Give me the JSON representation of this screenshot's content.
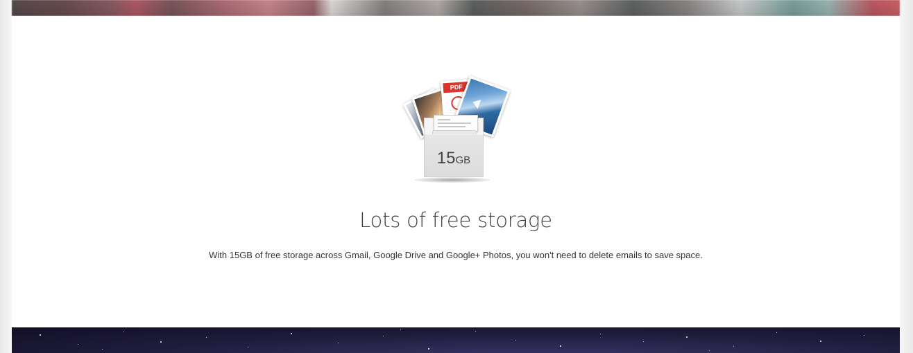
{
  "feature": {
    "storage_number": "15",
    "storage_unit": "GB",
    "pdf_badge": "PDF",
    "title": "Lots of free storage",
    "description": "With 15GB of free storage across Gmail, Google Drive and Google+ Photos, you won't need to delete emails to save space."
  },
  "icons": {
    "storage": "folder-with-files-icon",
    "pdf": "pdf-file-icon",
    "play": "play-icon"
  },
  "colors": {
    "pdf_red": "#d9342b",
    "panel_background": "#ffffff",
    "title_text": "#404040",
    "body_text": "#333333",
    "night_sky": "#1f1c3d"
  }
}
